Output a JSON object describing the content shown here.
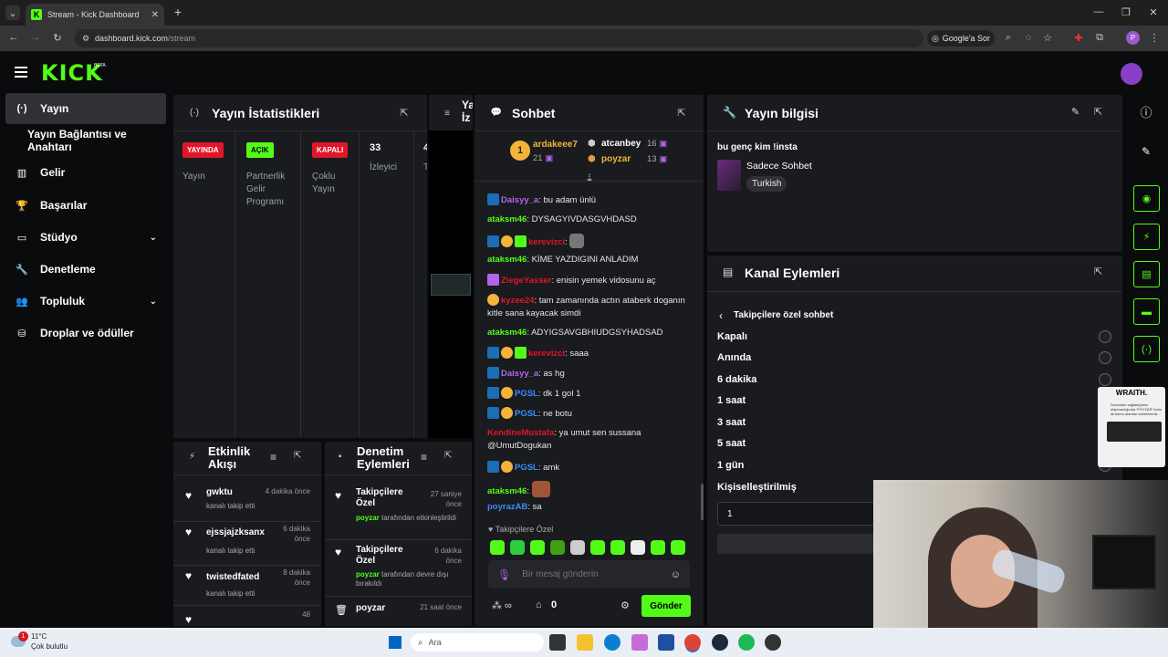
{
  "browser": {
    "tab_title": "Stream - Kick Dashboard",
    "url_domain": "dashboard.kick.com",
    "url_path": "/stream",
    "google_lens": "Google'a Sor"
  },
  "sidebar": {
    "items": [
      {
        "label": "Yayın",
        "icon": "broadcast-icon"
      },
      {
        "label": "Yayın Bağlantısı ve Anahtarı"
      },
      {
        "label": "Gelir",
        "icon": "chart-icon"
      },
      {
        "label": "Başarılar",
        "icon": "trophy-icon"
      },
      {
        "label": "Stüdyo",
        "icon": "studio-icon"
      },
      {
        "label": "Denetleme",
        "icon": "wrench-icon"
      },
      {
        "label": "Topluluk",
        "icon": "community-icon"
      },
      {
        "label": "Droplar ve ödüller",
        "icon": "drops-icon"
      }
    ]
  },
  "stats": {
    "title": "Yayın İstatistikleri",
    "cols": [
      {
        "badge": "YAYINDA",
        "label": "Yayın"
      },
      {
        "badge": "AÇIK",
        "label": "Partnerlik Gelir Programı"
      },
      {
        "badge": "KAPALI",
        "label": "Çoklu Yayın"
      },
      {
        "value": "33",
        "label": "İzleyici"
      },
      {
        "value": "4",
        "label": "T"
      }
    ]
  },
  "preview": {
    "title": "Ya İz"
  },
  "chat": {
    "title": "Sohbet",
    "top": [
      {
        "rank": "1",
        "name": "ardakeee7",
        "count": "21"
      },
      {
        "name": "atcanbey",
        "count": "16"
      },
      {
        "name": "poyzar",
        "count": "13"
      }
    ],
    "messages": [
      {
        "user": "Daisyy_a",
        "text": "bu adam ünlü"
      },
      {
        "user": "ataksm46",
        "text": "DYSAGYIVDASGVHDASD"
      },
      {
        "user": "kerevizci",
        "text": ""
      },
      {
        "user": "ataksm46",
        "text": "KİME YAZDIGINI ANLADIM"
      },
      {
        "user": "ZiegeYasser",
        "text": "enisin yemek vidosunu aç"
      },
      {
        "user": "kyzee24",
        "text": "tam zamanında actın ataberk doganın kitle sana kayacak simdi"
      },
      {
        "user": "ataksm46",
        "text": "ADYIGSAVGBHIUDGSYHADSAD"
      },
      {
        "user": "kerevizci",
        "text": "saaa"
      },
      {
        "user": "Daisyy_a",
        "text": "as hg"
      },
      {
        "user": "PGSL",
        "text": "dk 1 gol 1"
      },
      {
        "user": "PGSL",
        "text": "ne botu"
      },
      {
        "user": "KendineMustafa",
        "text": "ya umut sen sussana @UmutDogukan"
      },
      {
        "user": "PGSL",
        "text": "amk"
      },
      {
        "user": "ataksm46",
        "text": ""
      },
      {
        "user": "poyrazAB",
        "text": "sa"
      }
    ],
    "follower_label": "Takipçilere Özel",
    "input_placeholder": "Bir mesaj gönderin",
    "points": "0",
    "send": "Gönder"
  },
  "activity": {
    "title": "Etkinlik Akışı",
    "items": [
      {
        "name": "gwktu",
        "time": "4 dakika önce",
        "desc": "kanalı takip etti"
      },
      {
        "name": "ejssjajzksanx",
        "time": "6 dakika önce",
        "desc": "kanalı takip etti"
      },
      {
        "name": "twistedfated",
        "time": "8 dakika önce",
        "desc": "kanalı takip etti"
      },
      {
        "name": "",
        "time": "48",
        "desc": ""
      }
    ]
  },
  "modlog": {
    "title": "Denetim Eylemleri",
    "items": [
      {
        "title": "Takipçilere Özel",
        "time": "27 saniye önce",
        "by": "poyzar",
        "desc": "tarafından etkinleştirildi"
      },
      {
        "title": "Takipçilere Özel",
        "time": "6 dakika önce",
        "by": "poyzar",
        "desc": "tarafından devre dışı bırakıldı"
      },
      {
        "title": "poyzar",
        "time": "21 saat önce",
        "by": "",
        "desc": ""
      }
    ]
  },
  "info": {
    "title": "Yayın bilgisi",
    "stream_title": "bu genç kim !insta",
    "category": "Sadece Sohbet",
    "tag": "Turkish"
  },
  "channel": {
    "title": "Kanal Eylemleri",
    "section": "Takipçilere özel sohbet",
    "options": [
      "Kapalı",
      "Anında",
      "6 dakika",
      "1 saat",
      "3 saat",
      "5 saat",
      "1 gün",
      "Kişiselleştirilmiş"
    ],
    "custom_value": "1"
  },
  "ad": {
    "brand": "WRAITH.",
    "text": "Sonradan sağladığımız ekipmanlığında 'POYZAR' kodu ile kamu alardan sebebiseniz"
  },
  "taskbar": {
    "weather_temp": "11°C",
    "weather_desc": "Çok bulutlu",
    "notif": "1",
    "search": "Ara"
  },
  "colors": {
    "brand": "#53fc18",
    "panel": "#191b1f",
    "bg": "#0a0b0d"
  }
}
